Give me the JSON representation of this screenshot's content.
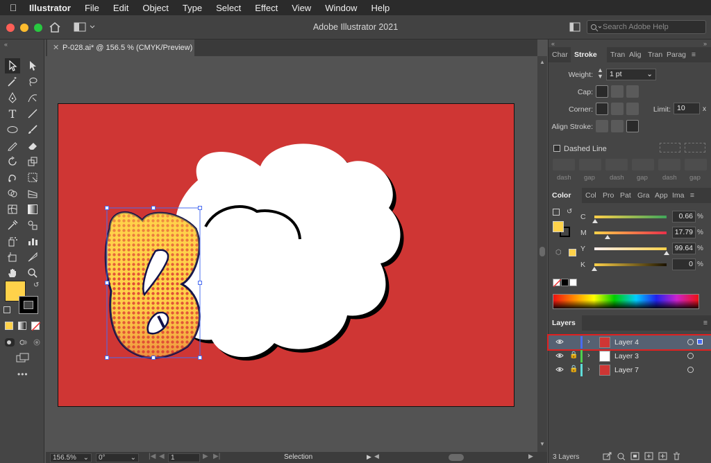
{
  "menubar": {
    "app_name": "Illustrator",
    "items": [
      "File",
      "Edit",
      "Object",
      "Type",
      "Select",
      "Effect",
      "View",
      "Window",
      "Help"
    ]
  },
  "titlebar": {
    "title": "Adobe Illustrator 2021",
    "search_placeholder": "Search Adobe Help"
  },
  "document": {
    "tab_label": "P-028.ai* @ 156.5 % (CMYK/Preview)",
    "artboard_color": "#cf3634"
  },
  "statusbar": {
    "zoom": "156.5%",
    "rotation": "0°",
    "artboard_number": "1",
    "tool_status": "Selection"
  },
  "stroke_panel": {
    "tabs": [
      "Char",
      "Stroke",
      "Tran",
      "Alig",
      "Tran",
      "Parag"
    ],
    "active_tab": "Stroke",
    "weight_label": "Weight:",
    "weight_value": "1 pt",
    "cap_label": "Cap:",
    "corner_label": "Corner:",
    "limit_label": "Limit:",
    "limit_value": "10",
    "limit_unit": "x",
    "align_label": "Align Stroke:",
    "dashed_label": "Dashed Line",
    "dash_labels": [
      "dash",
      "gap",
      "dash",
      "gap",
      "dash",
      "gap"
    ]
  },
  "color_panel": {
    "tabs": [
      "Color",
      "Col",
      "Pro",
      "Pat",
      "Gra",
      "App",
      "Ima"
    ],
    "active_tab": "Color",
    "fill_color": "#ffd24a",
    "channels": [
      {
        "label": "C",
        "value": "0.66",
        "level": 0.0066
      },
      {
        "label": "M",
        "value": "17.79",
        "level": 0.1779
      },
      {
        "label": "Y",
        "value": "99.64",
        "level": 0.9964
      },
      {
        "label": "K",
        "value": "0",
        "level": 0
      }
    ],
    "pct": "%"
  },
  "layers_panel": {
    "title": "Layers",
    "layers": [
      {
        "name": "Layer 4",
        "selected": true,
        "color": "#4a6cf0"
      },
      {
        "name": "Layer 3",
        "selected": false,
        "color": "#4fd04f"
      },
      {
        "name": "Layer 7",
        "selected": false,
        "color": "#5fdcd8"
      }
    ],
    "count_label": "3 Layers"
  },
  "toolbar": {
    "fill_color": "#ffd24a",
    "stroke_color": "#000000",
    "more_label": "•••"
  }
}
